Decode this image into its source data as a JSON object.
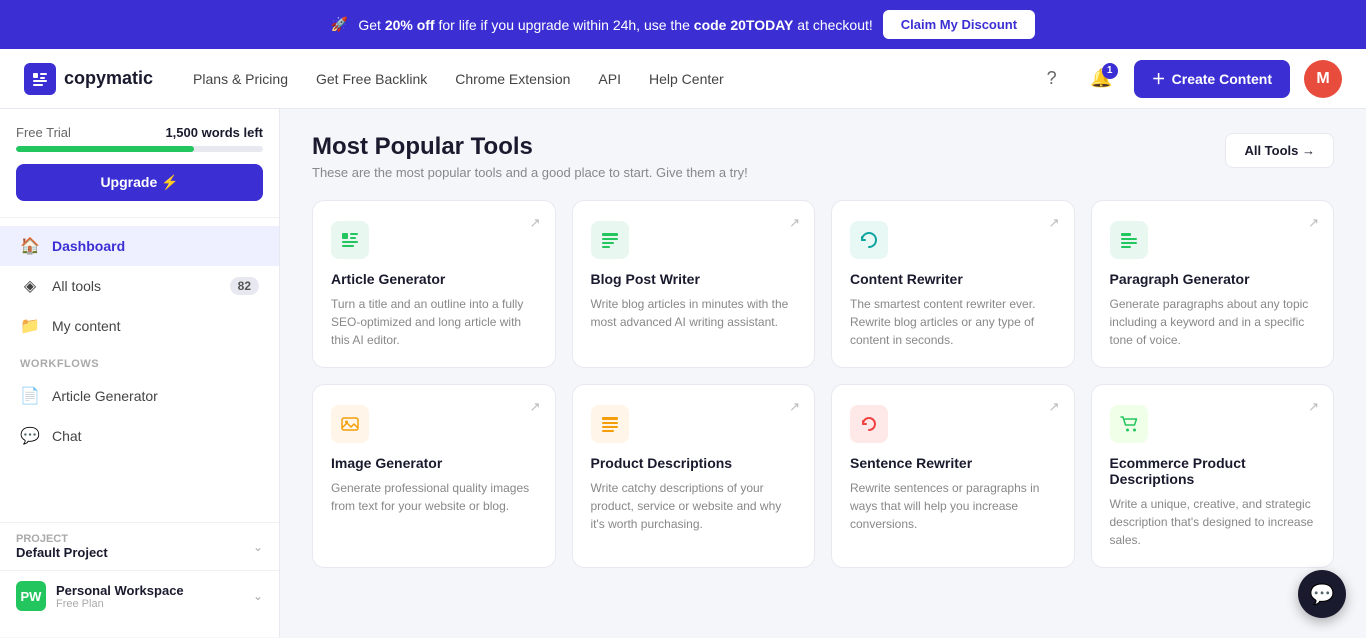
{
  "banner": {
    "text_prefix": "Get",
    "bold_text": "20% off",
    "text_middle": "for life if you upgrade within 24h, use the",
    "code": "code 20TODAY",
    "text_suffix": "at checkout!",
    "cta": "Claim My Discount",
    "icon": "🚀"
  },
  "navbar": {
    "logo_text": "copymatic",
    "links": [
      {
        "label": "Plans & Pricing",
        "key": "plans"
      },
      {
        "label": "Get Free Backlink",
        "key": "backlink"
      },
      {
        "label": "Chrome Extension",
        "key": "chrome"
      },
      {
        "label": "API",
        "key": "api"
      },
      {
        "label": "Help Center",
        "key": "help"
      }
    ],
    "notif_count": "1",
    "create_label": "Create Content",
    "avatar_letter": "M"
  },
  "sidebar": {
    "trial_label": "Free Trial",
    "words_left": "1,500 words left",
    "progress_pct": 72,
    "upgrade_label": "Upgrade ⚡",
    "nav_items": [
      {
        "label": "Dashboard",
        "icon": "🏠",
        "active": true,
        "badge": null
      },
      {
        "label": "All tools",
        "icon": "◈",
        "active": false,
        "badge": "82"
      },
      {
        "label": "My content",
        "icon": "📁",
        "active": false,
        "badge": null
      }
    ],
    "workflows_label": "Workflows",
    "workflow_items": [
      {
        "label": "Article Generator",
        "icon": "📄",
        "active": false
      },
      {
        "label": "Chat",
        "icon": "💬",
        "active": false
      }
    ],
    "project_label": "PROJECT",
    "project_name": "Default Project",
    "workspace_initials": "PW",
    "workspace_name": "Personal Workspace",
    "workspace_role": "Free Plan"
  },
  "main": {
    "title": "Most Popular Tools",
    "subtitle": "These are the most popular tools and a good place to start. Give them a try!",
    "all_tools_label": "All Tools →",
    "tools": [
      {
        "name": "Article Generator",
        "desc": "Turn a title and an outline into a fully SEO-optimized and long article with this AI editor.",
        "icon": "📝",
        "icon_class": "icon-green-light"
      },
      {
        "name": "Blog Post Writer",
        "desc": "Write blog articles in minutes with the most advanced AI writing assistant.",
        "icon": "📋",
        "icon_class": "icon-green-light"
      },
      {
        "name": "Content Rewriter",
        "desc": "The smartest content rewriter ever. Rewrite blog articles or any type of content in seconds.",
        "icon": "🔄",
        "icon_class": "icon-teal-light"
      },
      {
        "name": "Paragraph Generator",
        "desc": "Generate paragraphs about any topic including a keyword and in a specific tone of voice.",
        "icon": "¶",
        "icon_class": "icon-green-light"
      },
      {
        "name": "Image Generator",
        "desc": "Generate professional quality images from text for your website or blog.",
        "icon": "🖼️",
        "icon_class": "icon-orange-light"
      },
      {
        "name": "Product Descriptions",
        "desc": "Write catchy descriptions of your product, service or website and why it's worth purchasing.",
        "icon": "≡",
        "icon_class": "icon-orange-light"
      },
      {
        "name": "Sentence Rewriter",
        "desc": "Rewrite sentences or paragraphs in ways that will help you increase conversions.",
        "icon": "↺",
        "icon_class": "icon-red-light"
      },
      {
        "name": "Ecommerce Product Descriptions",
        "desc": "Write a unique, creative, and strategic description that's designed to increase sales.",
        "icon": "🛒",
        "icon_class": "icon-green2-light"
      }
    ]
  }
}
